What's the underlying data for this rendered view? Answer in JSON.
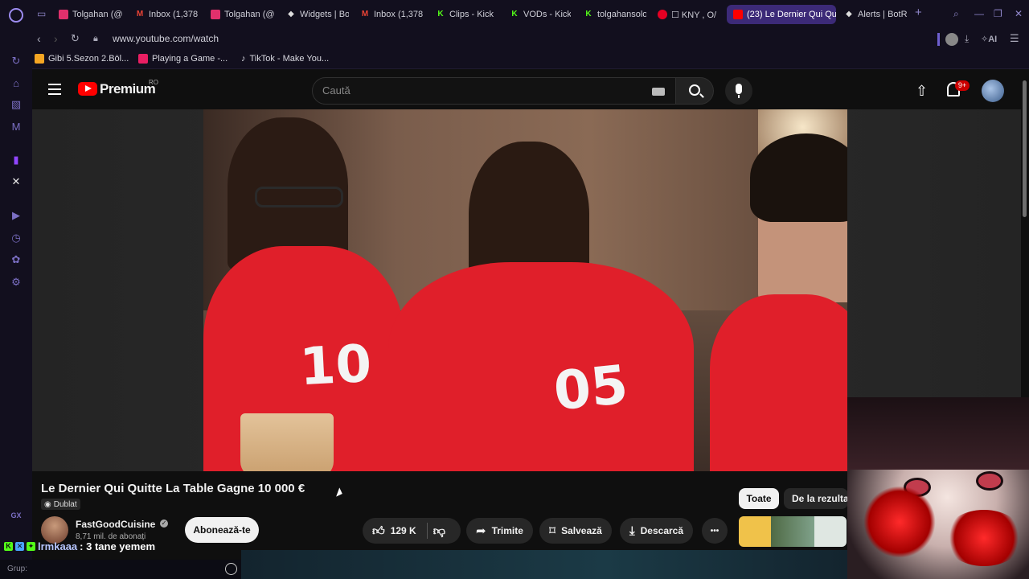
{
  "browser": {
    "tabs": [
      {
        "label": "Tolgahan (@",
        "icon": "instagram-icon",
        "color": "#e1306c"
      },
      {
        "label": "Inbox (1,378",
        "icon": "gmail-icon",
        "color": "#ea4335"
      },
      {
        "label": "Tolgahan (@",
        "icon": "instagram-icon",
        "color": "#e1306c"
      },
      {
        "label": "Widgets | Bo",
        "icon": "botrix-icon",
        "color": "#dddddd"
      },
      {
        "label": "Inbox (1,378",
        "icon": "gmail-icon",
        "color": "#ea4335"
      },
      {
        "label": "Clips - Kick",
        "icon": "kick-icon",
        "color": "#53fc18"
      },
      {
        "label": "VODs - Kick",
        "icon": "kick-icon",
        "color": "#53fc18"
      },
      {
        "label": "tolgahansolo",
        "icon": "kick-icon",
        "color": "#53fc18"
      },
      {
        "label": "☐ KNY , O/",
        "icon": "pinterest-icon",
        "color": "#e60023"
      },
      {
        "label": "(23) Le Dernier Qui Qu",
        "icon": "youtube-icon",
        "color": "#ff0000"
      },
      {
        "label": "Alerts | BotR",
        "icon": "botrix-icon",
        "color": "#dddddd"
      }
    ],
    "url": "www.youtube.com/watch",
    "ai_label": "AI",
    "bookmarks": [
      {
        "label": "Gibi 5.Sezon 2.Böl...",
        "color": "#f5a623"
      },
      {
        "label": "Playing a Game -...",
        "color": "#e91e63"
      },
      {
        "label": "TikTok - Make You...",
        "color": "#ffffff"
      }
    ]
  },
  "youtube": {
    "brand": "Premium",
    "region": "RO",
    "search_placeholder": "Caută",
    "notif_count": "9+",
    "video": {
      "title": "Le Dernier Qui Quitte La Table Gagne 10 000 €",
      "dub_label": "Dublat",
      "jersey_left": "10",
      "jersey_center": "05"
    },
    "channel": {
      "name": "FastGoodCuisine",
      "subscribers": "8,71 mil. de abonați",
      "subscribe_label": "Abonează-te"
    },
    "actions": {
      "likes": "129 K",
      "share": "Trimite",
      "save": "Salvează",
      "download": "Descarcă",
      "more": "•••"
    },
    "chips": {
      "all": "Toate",
      "from_results": "De la rezultat"
    }
  },
  "overlay": {
    "chat_user": "lrmkaaa",
    "chat_message": ": 3 tane yemem",
    "group_label": "Grup:"
  },
  "sidebar": {
    "gx_label": "GX"
  }
}
